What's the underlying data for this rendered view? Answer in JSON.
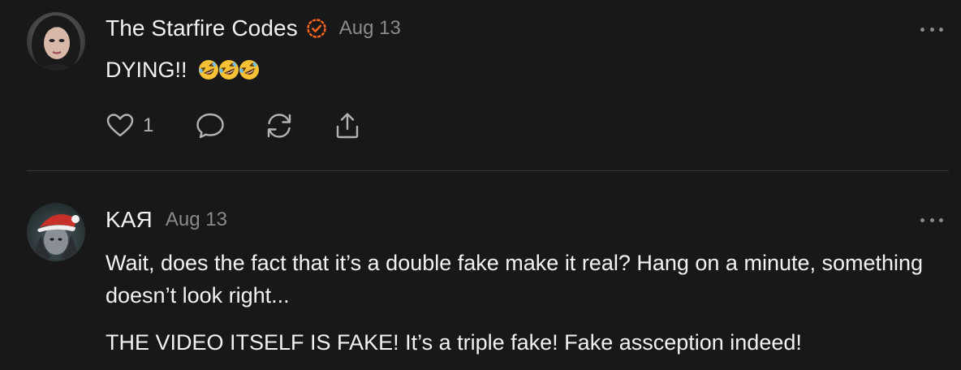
{
  "colors": {
    "background": "#181818",
    "text": "#f2f2f2",
    "muted": "#8a8a8a",
    "icon": "#b3b3b3",
    "divider": "#3a3a3a",
    "verified": "#ff6719"
  },
  "posts": [
    {
      "author": "The Starfire Codes",
      "verified": true,
      "verified_icon": "check-badge-icon",
      "date": "Aug 13",
      "text": "DYING!!",
      "emojis": [
        "🤣",
        "🤣",
        "🤣"
      ],
      "likes": "1",
      "actions": [
        "heart-icon",
        "comment-icon",
        "restack-icon",
        "share-icon"
      ]
    },
    {
      "author": "KAЯ",
      "verified": false,
      "date": "Aug 13",
      "paragraphs": [
        "Wait, does the fact that it’s a double fake make it real? Hang on a minute, something doesn’t look right...",
        "THE VIDEO ITSELF IS FAKE! It’s a triple fake! Fake assception indeed!"
      ]
    }
  ]
}
